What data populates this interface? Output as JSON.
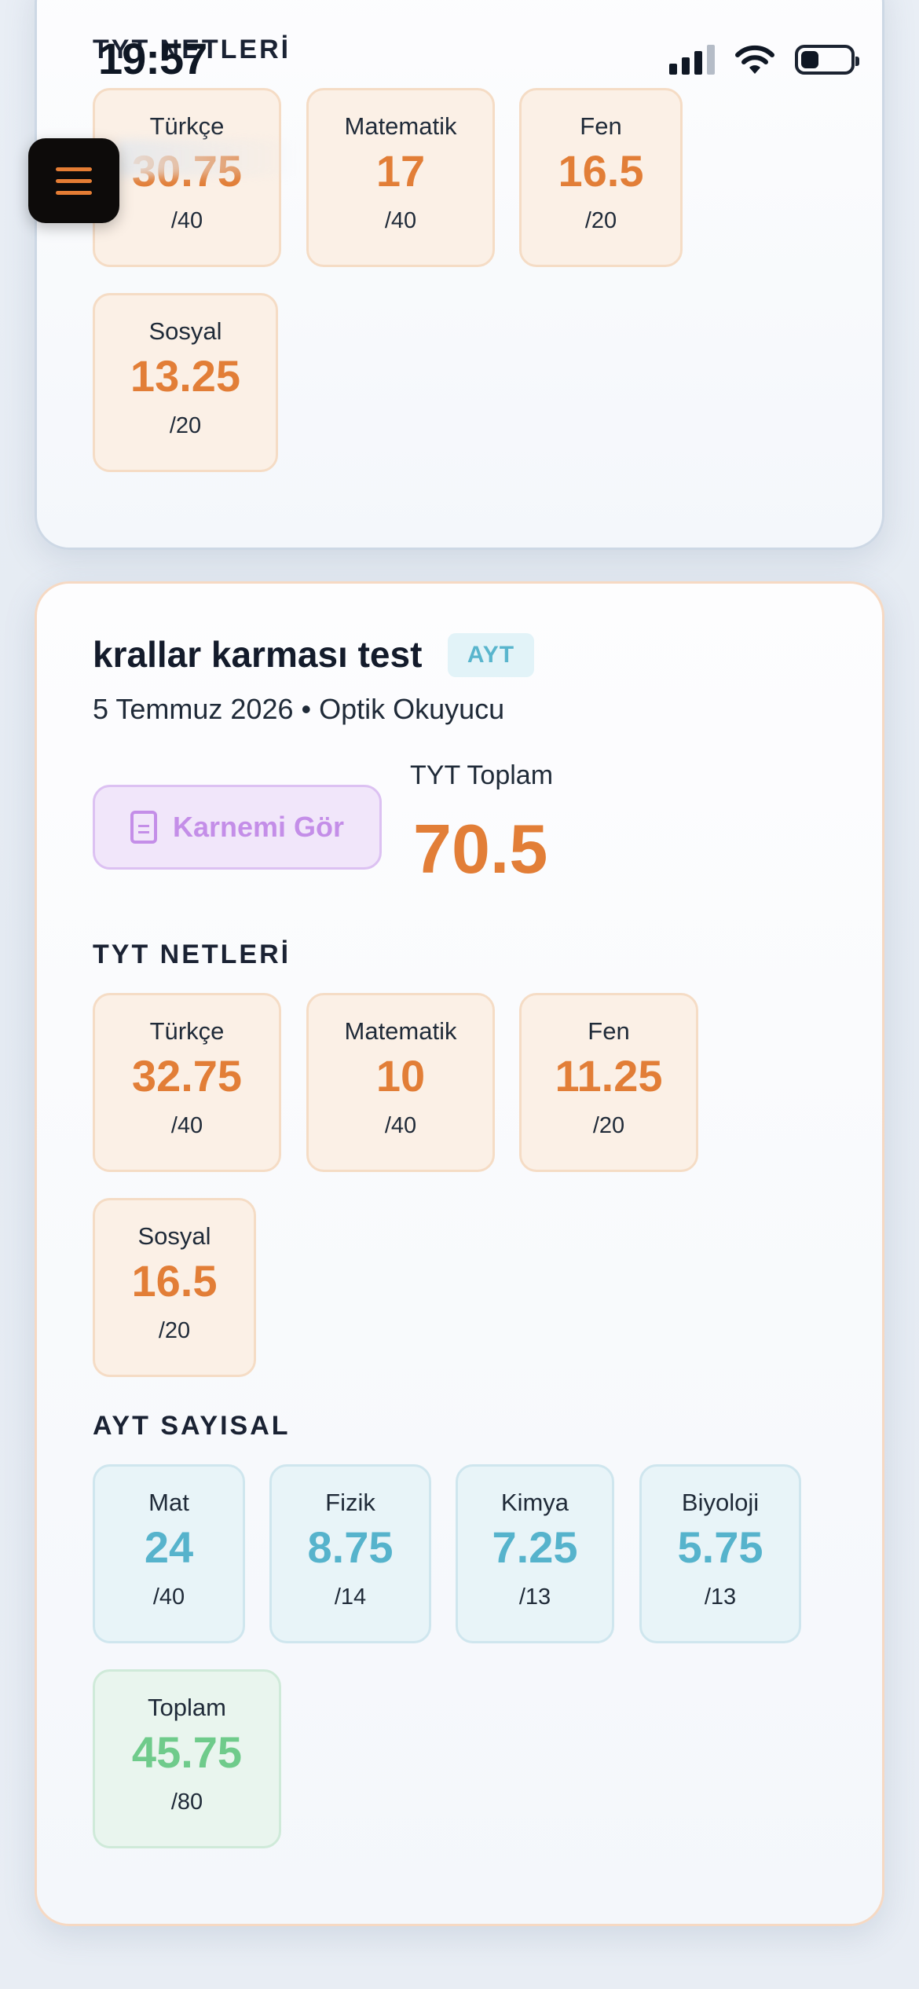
{
  "status_bar": {
    "time": "19:57"
  },
  "top_card": {
    "section_title": "TYT NETLERİ",
    "nets": [
      {
        "label": "Türkçe",
        "value": "30.75",
        "max": "/40"
      },
      {
        "label": "Matematik",
        "value": "17",
        "max": "/40"
      },
      {
        "label": "Fen",
        "value": "16.5",
        "max": "/20"
      },
      {
        "label": "Sosyal",
        "value": "13.25",
        "max": "/20"
      }
    ]
  },
  "exam": {
    "title": "krallar karması test",
    "badge": "AYT",
    "meta": "5 Temmuz 2026 • Optik Okuyucu",
    "report_button": "Karnemi Gör",
    "tyt_total_label": "TYT Toplam",
    "tyt_total_value": "70.5",
    "tyt_section_title": "TYT NETLERİ",
    "tyt_nets": [
      {
        "label": "Türkçe",
        "value": "32.75",
        "max": "/40"
      },
      {
        "label": "Matematik",
        "value": "10",
        "max": "/40"
      },
      {
        "label": "Fen",
        "value": "11.25",
        "max": "/20"
      },
      {
        "label": "Sosyal",
        "value": "16.5",
        "max": "/20"
      }
    ],
    "ayt_section_title": "AYT SAYISAL",
    "ayt_nets": [
      {
        "label": "Mat",
        "value": "24",
        "max": "/40"
      },
      {
        "label": "Fizik",
        "value": "8.75",
        "max": "/14"
      },
      {
        "label": "Kimya",
        "value": "7.25",
        "max": "/13"
      },
      {
        "label": "Biyoloji",
        "value": "5.75",
        "max": "/13"
      }
    ],
    "ayt_total": {
      "label": "Toplam",
      "value": "45.75",
      "max": "/80"
    }
  },
  "colors": {
    "accent_orange": "#e27e37",
    "accent_blue": "#56b3cc",
    "accent_green": "#6fcb8b",
    "accent_purple": "#c48ee8"
  }
}
